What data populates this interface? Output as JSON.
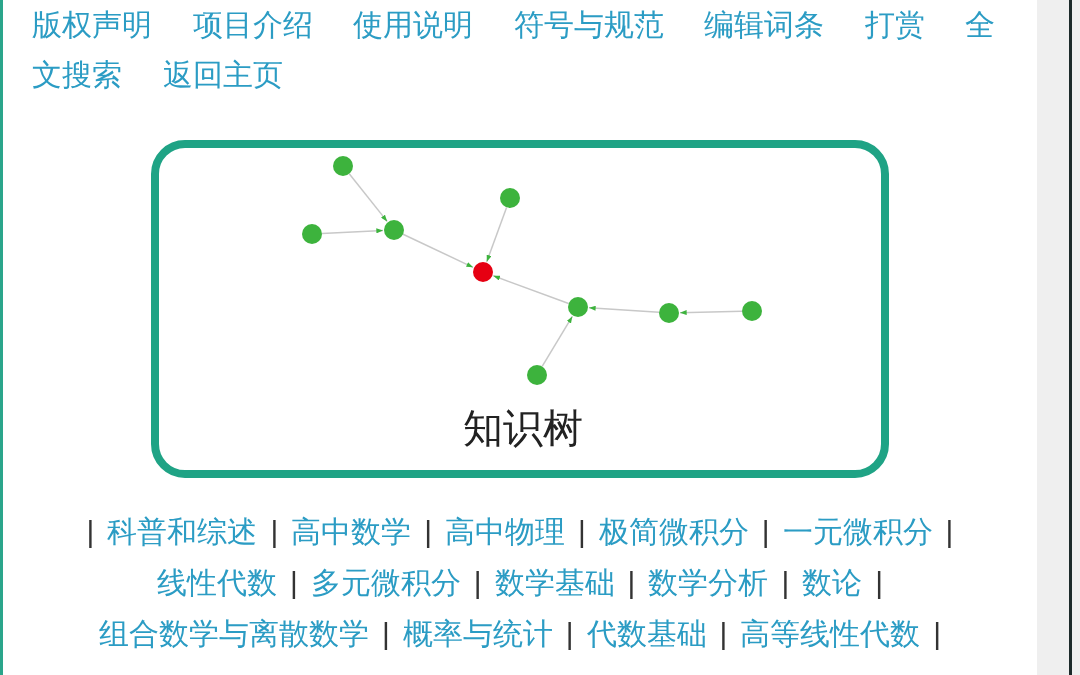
{
  "nav_rows": [
    [
      "版权声明",
      "项目介绍",
      "使用说明",
      "符号与规范",
      "编辑词条",
      "打赏",
      "全"
    ],
    [
      "文搜索",
      "返回主页"
    ]
  ],
  "knowledge_tree": {
    "title": "知识树"
  },
  "leading_separator": "|",
  "category_links": [
    {
      "label": "科普和综述",
      "separator": "|"
    },
    {
      "label": "高中数学",
      "separator": "|"
    },
    {
      "label": "高中物理",
      "separator": "|"
    },
    {
      "label": "极简微积分",
      "separator": "|"
    },
    {
      "label": "一元微积分",
      "separator": "|"
    },
    {
      "label": "线性代数",
      "separator": "|"
    },
    {
      "label": "多元微积分",
      "separator": "|"
    },
    {
      "label": "数学基础",
      "separator": "|"
    },
    {
      "label": "数学分析",
      "separator": "|"
    },
    {
      "label": "数论",
      "separator": "|"
    },
    {
      "label": "组合数学与离散数学",
      "separator": "|"
    },
    {
      "label": "概率与统计",
      "separator": "|"
    },
    {
      "label": "代数基础",
      "separator": "|"
    },
    {
      "label": "高等线性代数",
      "separator": "|"
    }
  ]
}
